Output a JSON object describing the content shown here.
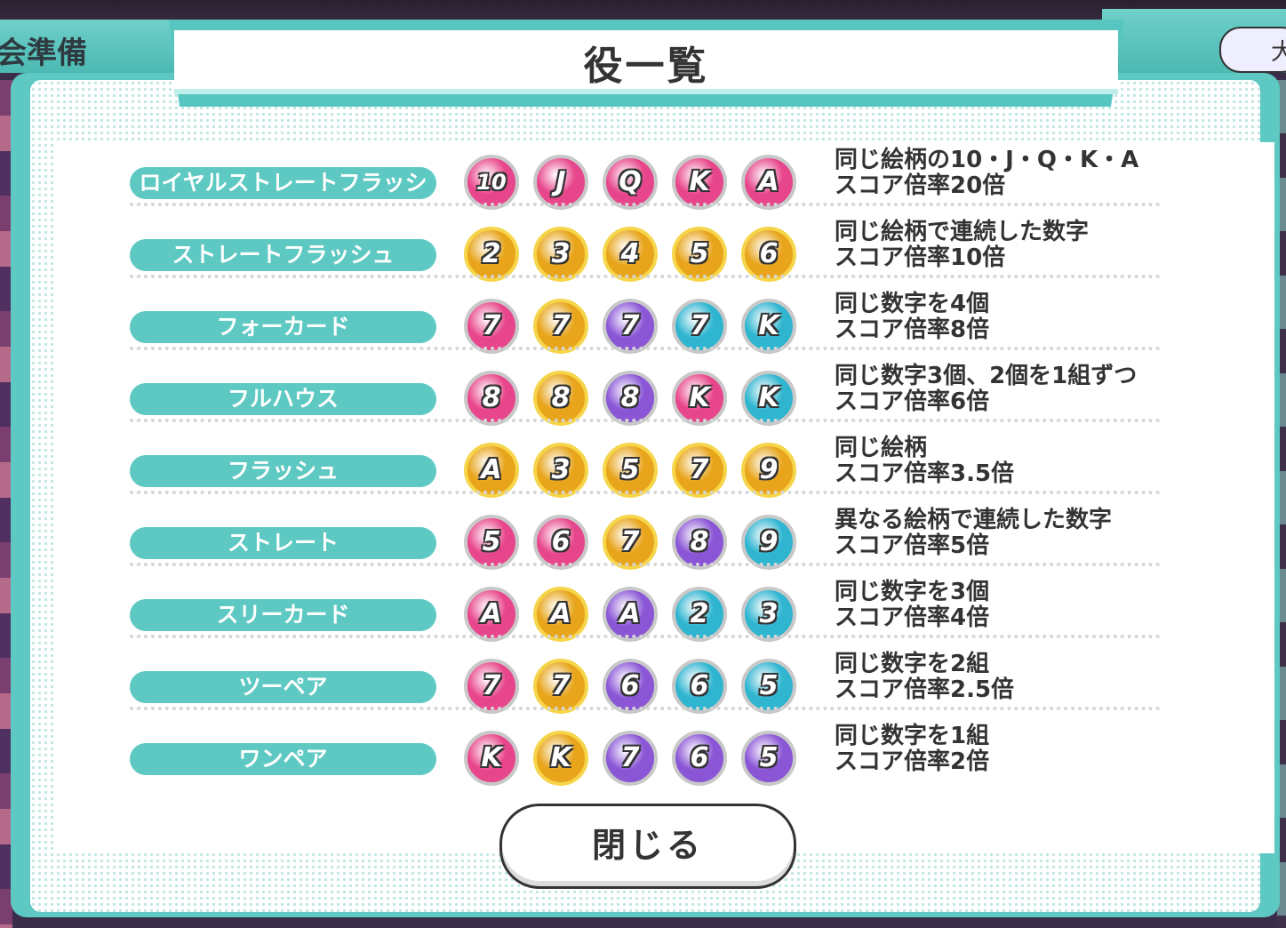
{
  "background": {
    "header_left_text": "会準備",
    "header_right_text": "大"
  },
  "dialog": {
    "title": "役一覧",
    "close_label": "閉じる"
  },
  "suit_colors": {
    "pink": "#e8468c",
    "gold": "#e8a41a",
    "purple": "#8a56d6",
    "teal": "#2fb5d0"
  },
  "hands": [
    {
      "name": "ロイヤルストレートフラッシュ",
      "cards": [
        {
          "rank": "10",
          "suit": "pink"
        },
        {
          "rank": "J",
          "suit": "pink"
        },
        {
          "rank": "Q",
          "suit": "pink"
        },
        {
          "rank": "K",
          "suit": "pink"
        },
        {
          "rank": "A",
          "suit": "pink"
        }
      ],
      "desc_line1": "同じ絵柄の10・J・Q・K・A",
      "desc_line2": "スコア倍率20倍"
    },
    {
      "name": "ストレートフラッシュ",
      "cards": [
        {
          "rank": "2",
          "suit": "gold"
        },
        {
          "rank": "3",
          "suit": "gold"
        },
        {
          "rank": "4",
          "suit": "gold"
        },
        {
          "rank": "5",
          "suit": "gold"
        },
        {
          "rank": "6",
          "suit": "gold"
        }
      ],
      "desc_line1": "同じ絵柄で連続した数字",
      "desc_line2": "スコア倍率10倍"
    },
    {
      "name": "フォーカード",
      "cards": [
        {
          "rank": "7",
          "suit": "pink"
        },
        {
          "rank": "7",
          "suit": "gold"
        },
        {
          "rank": "7",
          "suit": "purple"
        },
        {
          "rank": "7",
          "suit": "teal"
        },
        {
          "rank": "K",
          "suit": "teal"
        }
      ],
      "desc_line1": "同じ数字を4個",
      "desc_line2": "スコア倍率8倍"
    },
    {
      "name": "フルハウス",
      "cards": [
        {
          "rank": "8",
          "suit": "pink"
        },
        {
          "rank": "8",
          "suit": "gold"
        },
        {
          "rank": "8",
          "suit": "purple"
        },
        {
          "rank": "K",
          "suit": "pink"
        },
        {
          "rank": "K",
          "suit": "teal"
        }
      ],
      "desc_line1": "同じ数字3個、2個を1組ずつ",
      "desc_line2": "スコア倍率6倍"
    },
    {
      "name": "フラッシュ",
      "cards": [
        {
          "rank": "A",
          "suit": "gold"
        },
        {
          "rank": "3",
          "suit": "gold"
        },
        {
          "rank": "5",
          "suit": "gold"
        },
        {
          "rank": "7",
          "suit": "gold"
        },
        {
          "rank": "9",
          "suit": "gold"
        }
      ],
      "desc_line1": "同じ絵柄",
      "desc_line2": "スコア倍率3.5倍"
    },
    {
      "name": "ストレート",
      "cards": [
        {
          "rank": "5",
          "suit": "pink"
        },
        {
          "rank": "6",
          "suit": "pink"
        },
        {
          "rank": "7",
          "suit": "gold"
        },
        {
          "rank": "8",
          "suit": "purple"
        },
        {
          "rank": "9",
          "suit": "teal"
        }
      ],
      "desc_line1": "異なる絵柄で連続した数字",
      "desc_line2": "スコア倍率5倍"
    },
    {
      "name": "スリーカード",
      "cards": [
        {
          "rank": "A",
          "suit": "pink"
        },
        {
          "rank": "A",
          "suit": "gold"
        },
        {
          "rank": "A",
          "suit": "purple"
        },
        {
          "rank": "2",
          "suit": "teal"
        },
        {
          "rank": "3",
          "suit": "teal"
        }
      ],
      "desc_line1": "同じ数字を3個",
      "desc_line2": "スコア倍率4倍"
    },
    {
      "name": "ツーペア",
      "cards": [
        {
          "rank": "7",
          "suit": "pink"
        },
        {
          "rank": "7",
          "suit": "gold"
        },
        {
          "rank": "6",
          "suit": "purple"
        },
        {
          "rank": "6",
          "suit": "teal"
        },
        {
          "rank": "5",
          "suit": "teal"
        }
      ],
      "desc_line1": "同じ数字を2組",
      "desc_line2": "スコア倍率2.5倍"
    },
    {
      "name": "ワンペア",
      "cards": [
        {
          "rank": "K",
          "suit": "pink"
        },
        {
          "rank": "K",
          "suit": "gold"
        },
        {
          "rank": "7",
          "suit": "purple"
        },
        {
          "rank": "6",
          "suit": "purple"
        },
        {
          "rank": "5",
          "suit": "purple"
        }
      ],
      "desc_line1": "同じ数字を1組",
      "desc_line2": "スコア倍率2倍"
    }
  ]
}
